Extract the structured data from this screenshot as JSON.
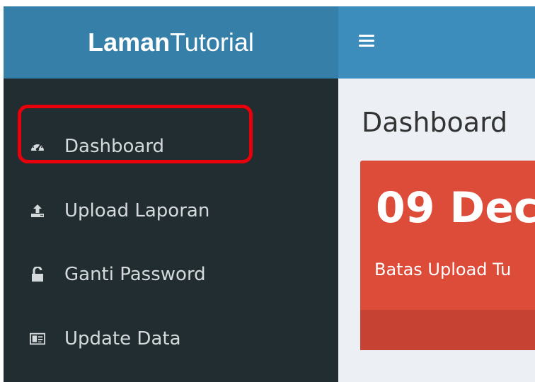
{
  "brand": {
    "bold": "Laman",
    "light": "Tutorial"
  },
  "sidebar": {
    "items": [
      {
        "label": "Dashboard",
        "icon": "dashboard-icon"
      },
      {
        "label": "Upload Laporan",
        "icon": "upload-icon"
      },
      {
        "label": "Ganti Password",
        "icon": "unlock-icon"
      },
      {
        "label": "Update Data",
        "icon": "id-card-icon"
      }
    ]
  },
  "main": {
    "page_title": "Dashboard",
    "info_box": {
      "big_text": "09 Dec",
      "small_text": "Batas Upload Tu"
    }
  },
  "colors": {
    "header_brand": "#367fa9",
    "header_nav": "#3c8dbc",
    "sidebar_bg": "#222d32",
    "content_bg": "#ecf0f5",
    "info_box": "#dd4b39",
    "highlight_border": "#e8000b"
  }
}
